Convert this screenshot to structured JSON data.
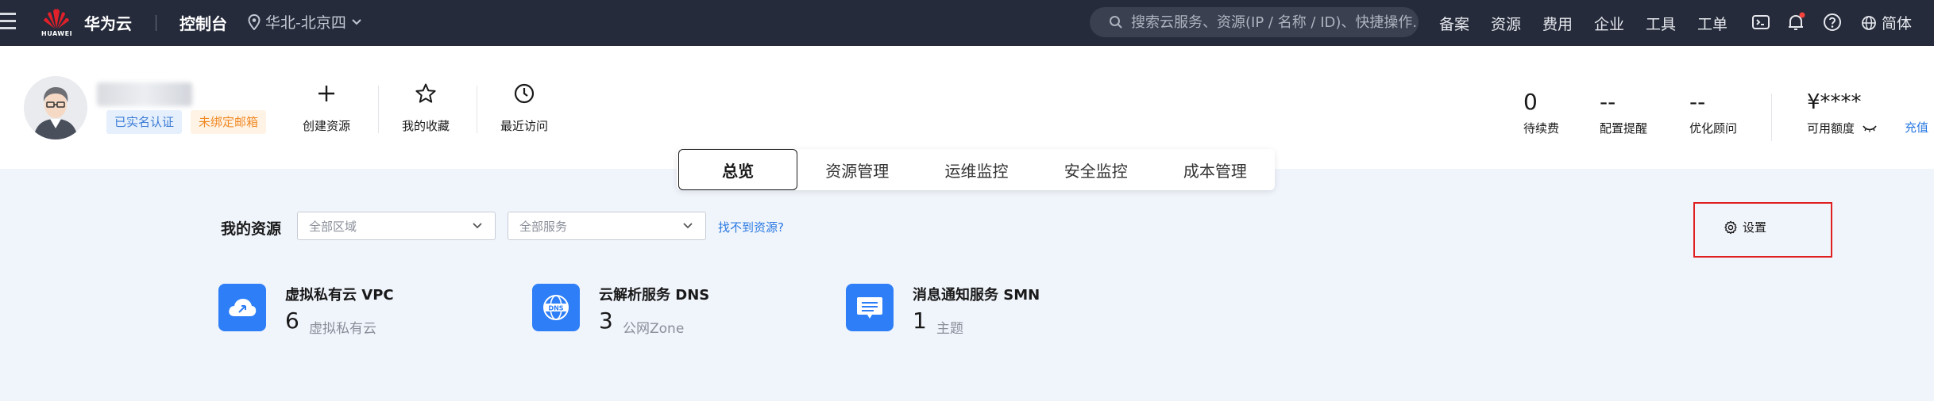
{
  "topbar": {
    "logo_text": "HUAWEI",
    "brand": "华为云",
    "console": "控制台",
    "region": "华北-北京四",
    "search_placeholder": "搜索云服务、资源(IP / 名称 / ID)、快捷操作...",
    "links": [
      "备案",
      "资源",
      "费用",
      "企业",
      "工具",
      "工单"
    ],
    "language": "简体"
  },
  "user": {
    "badge_verified": "已实名认证",
    "badge_unbound": "未绑定邮箱"
  },
  "quick_actions": [
    {
      "label": "创建资源",
      "icon": "plus-icon"
    },
    {
      "label": "我的收藏",
      "icon": "star-icon"
    },
    {
      "label": "最近访问",
      "icon": "clock-icon"
    }
  ],
  "stats": {
    "renewal": {
      "value": "0",
      "label": "待续费"
    },
    "config_alert": {
      "value": "--",
      "label": "配置提醒"
    },
    "optimize": {
      "value": "--",
      "label": "优化顾问"
    },
    "credit": {
      "value": "¥****",
      "label": "可用额度"
    },
    "recharge": "充值"
  },
  "tabs": [
    "总览",
    "资源管理",
    "运维监控",
    "安全监控",
    "成本管理"
  ],
  "active_tab": "总览",
  "resources": {
    "title": "我的资源",
    "region_select": "全部区域",
    "service_select": "全部服务",
    "not_found_link": "找不到资源?",
    "settings": "设置",
    "items": [
      {
        "name": "虚拟私有云 VPC",
        "count": "6",
        "unit": "虚拟私有云",
        "icon": "vpc-cloud-icon"
      },
      {
        "name": "云解析服务 DNS",
        "count": "3",
        "unit": "公网Zone",
        "icon": "dns-globe-icon"
      },
      {
        "name": "消息通知服务 SMN",
        "count": "1",
        "unit": "主题",
        "icon": "smn-message-icon"
      }
    ]
  },
  "colors": {
    "topbar_bg": "#252b3a",
    "accent": "#2d7ef7",
    "link": "#2a7ae2",
    "highlight_border": "#e02020",
    "body_bg": "#f0f4fb"
  }
}
